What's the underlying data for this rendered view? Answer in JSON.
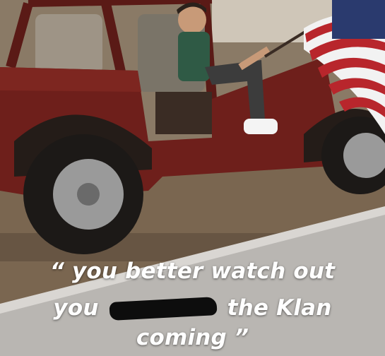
{
  "caption": {
    "line1": "“ you better watch out",
    "line2_before": "you",
    "line2_after": "the Klan",
    "line3": "coming ”"
  },
  "flag": {
    "colors": [
      "#b8262c",
      "#f2f2f2",
      "#2a3a6e"
    ]
  },
  "vehicle": {
    "color": "#6e1f1b"
  }
}
